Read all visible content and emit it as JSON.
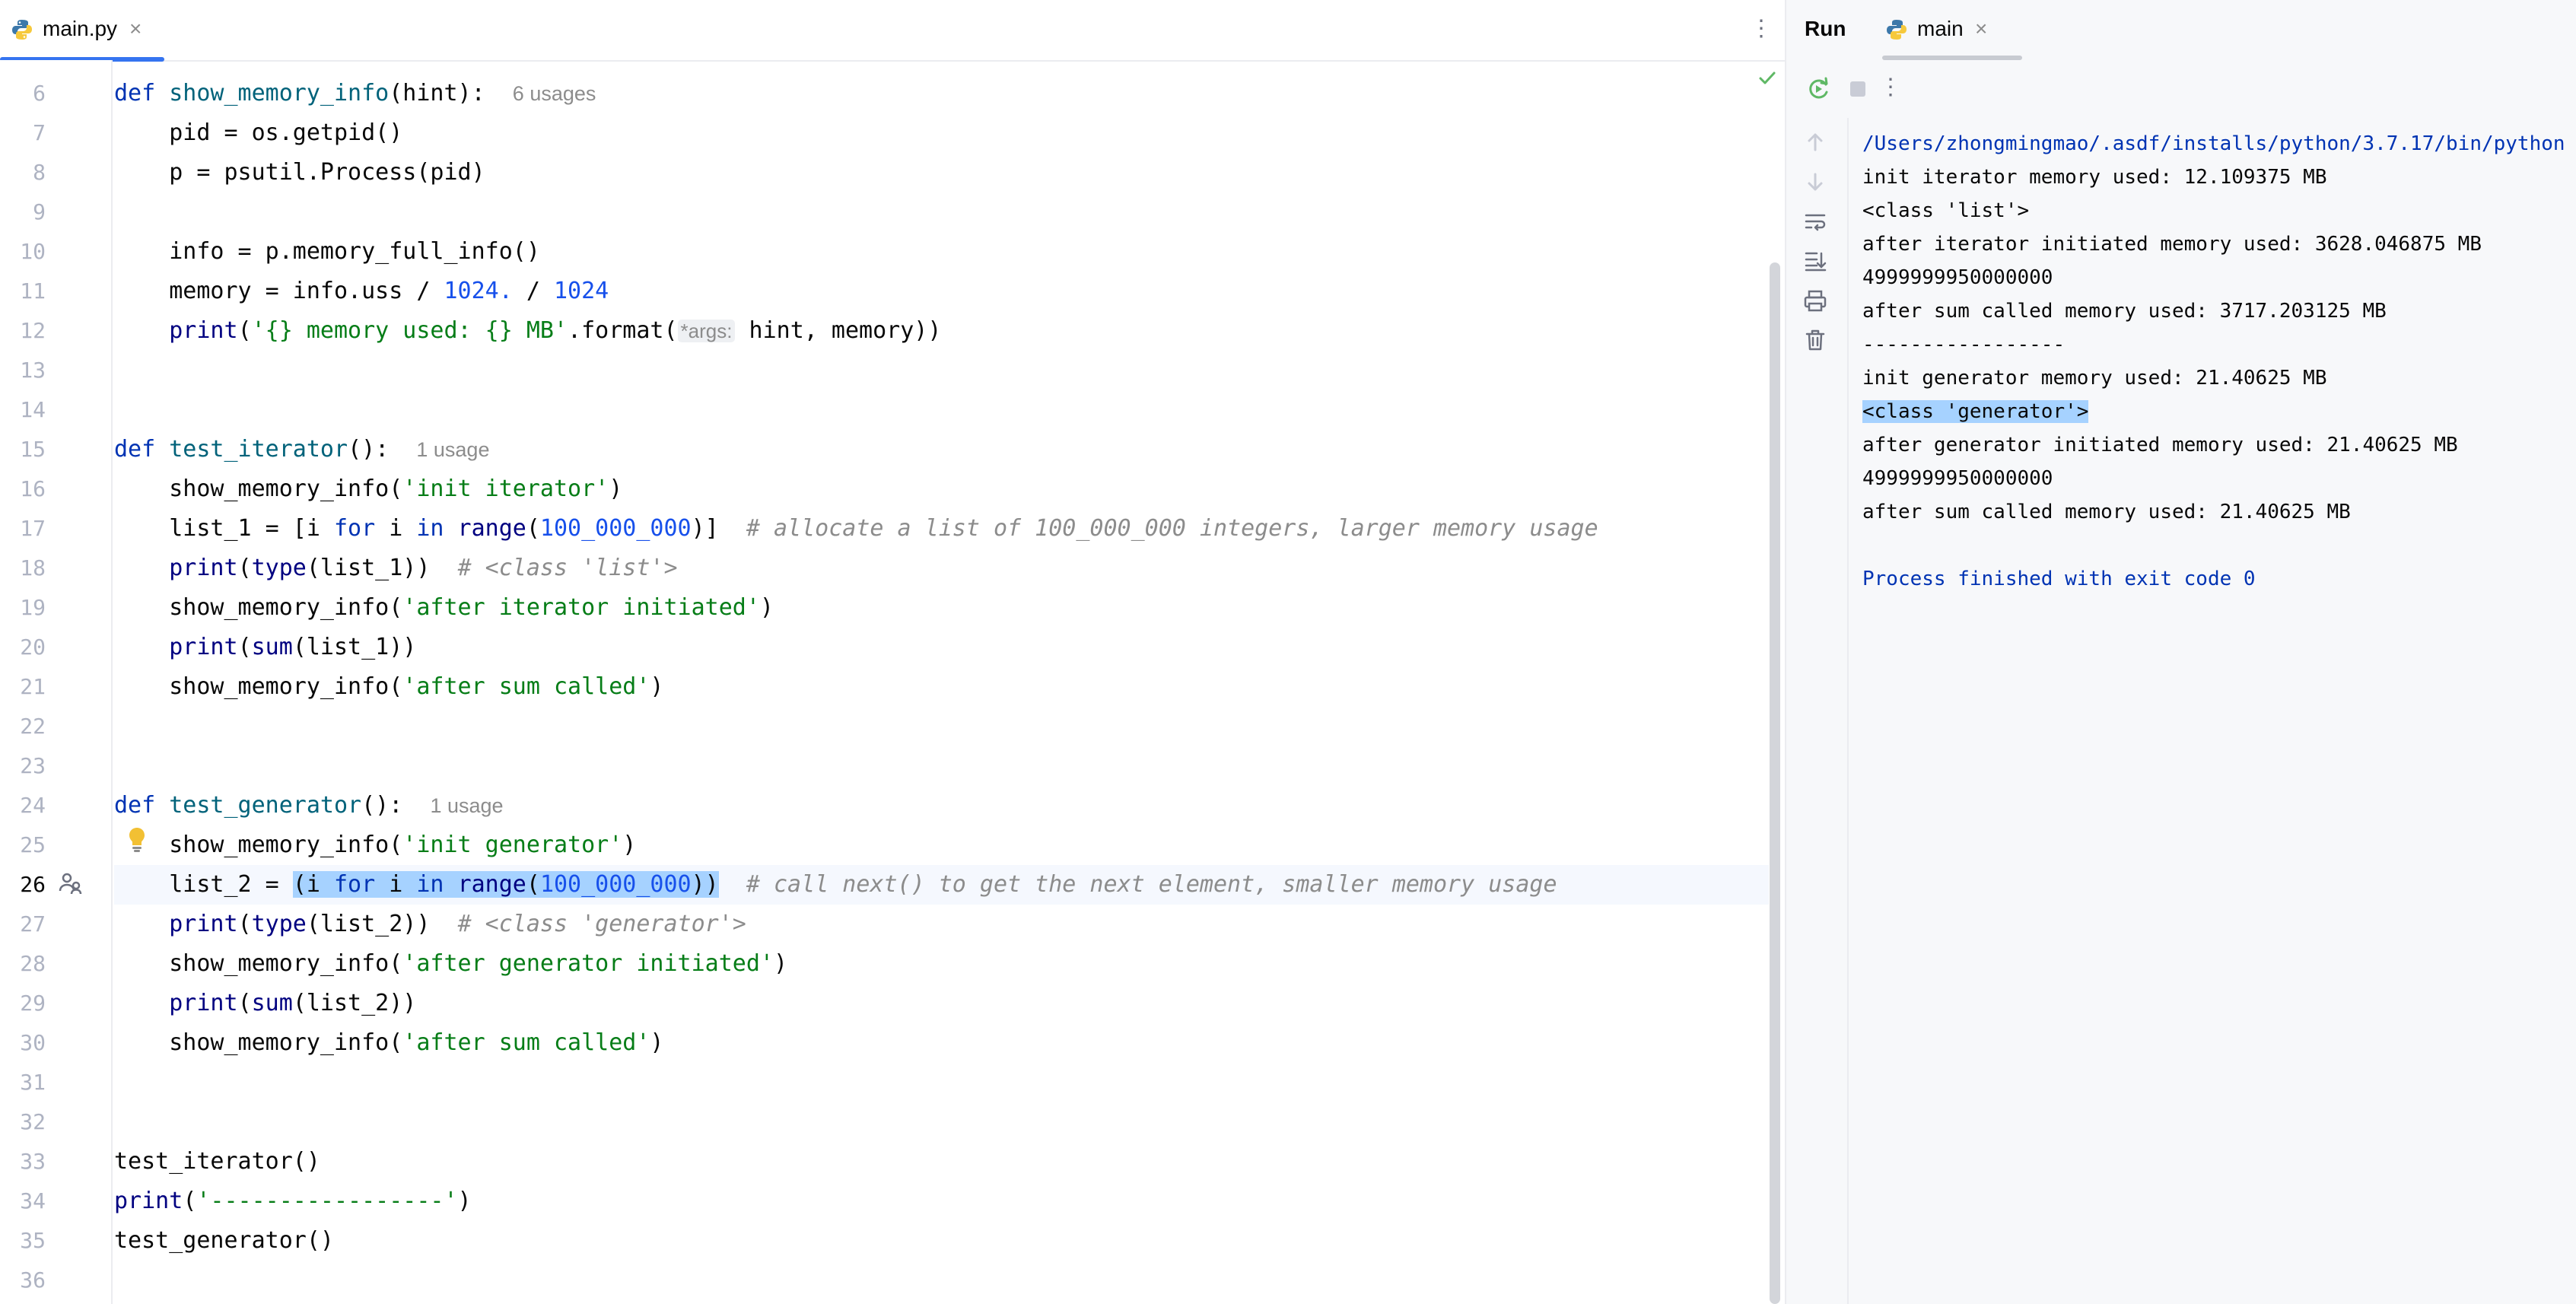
{
  "editor": {
    "tab": {
      "filename": "main.py",
      "close": "×"
    },
    "more_icon": "⋮",
    "lines": [
      {
        "n": "6",
        "tokens": [
          {
            "t": "def ",
            "c": "kw"
          },
          {
            "t": "show_memory_info",
            "c": "fn"
          },
          {
            "t": "(hint):  "
          },
          {
            "t": "6 usages",
            "c": "hint"
          }
        ]
      },
      {
        "n": "7",
        "tokens": [
          {
            "t": "    pid = os.getpid()"
          }
        ]
      },
      {
        "n": "8",
        "tokens": [
          {
            "t": "    p = psutil.Process(pid)"
          }
        ]
      },
      {
        "n": "9",
        "tokens": []
      },
      {
        "n": "10",
        "tokens": [
          {
            "t": "    info = p.memory_full_info()"
          }
        ]
      },
      {
        "n": "11",
        "tokens": [
          {
            "t": "    memory = info.uss / "
          },
          {
            "t": "1024.",
            "c": "num"
          },
          {
            "t": " / "
          },
          {
            "t": "1024",
            "c": "num"
          }
        ]
      },
      {
        "n": "12",
        "tokens": [
          {
            "t": "    "
          },
          {
            "t": "print",
            "c": "bi"
          },
          {
            "t": "("
          },
          {
            "t": "'{} memory used: {} MB'",
            "c": "str"
          },
          {
            "t": ".format("
          },
          {
            "t": "*args:",
            "c": "param"
          },
          {
            "t": " hint, memory))"
          }
        ]
      },
      {
        "n": "13",
        "tokens": []
      },
      {
        "n": "14",
        "tokens": []
      },
      {
        "n": "15",
        "tokens": [
          {
            "t": "def ",
            "c": "kw"
          },
          {
            "t": "test_iterator",
            "c": "fn"
          },
          {
            "t": "():  "
          },
          {
            "t": "1 usage",
            "c": "hint"
          }
        ]
      },
      {
        "n": "16",
        "tokens": [
          {
            "t": "    show_memory_info("
          },
          {
            "t": "'init iterator'",
            "c": "str"
          },
          {
            "t": ")"
          }
        ]
      },
      {
        "n": "17",
        "tokens": [
          {
            "t": "    list_1 = [i "
          },
          {
            "t": "for",
            "c": "kw"
          },
          {
            "t": " i "
          },
          {
            "t": "in",
            "c": "kw"
          },
          {
            "t": " "
          },
          {
            "t": "range",
            "c": "bi"
          },
          {
            "t": "("
          },
          {
            "t": "100_000_000",
            "c": "num"
          },
          {
            "t": ")]  "
          },
          {
            "t": "# allocate a list of 100_000_000 integers, larger memory usage",
            "c": "cm"
          }
        ]
      },
      {
        "n": "18",
        "tokens": [
          {
            "t": "    "
          },
          {
            "t": "print",
            "c": "bi"
          },
          {
            "t": "("
          },
          {
            "t": "type",
            "c": "bi"
          },
          {
            "t": "(list_1))  "
          },
          {
            "t": "# <class 'list'>",
            "c": "cm"
          }
        ]
      },
      {
        "n": "19",
        "tokens": [
          {
            "t": "    show_memory_info("
          },
          {
            "t": "'after iterator initiated'",
            "c": "str"
          },
          {
            "t": ")"
          }
        ]
      },
      {
        "n": "20",
        "tokens": [
          {
            "t": "    "
          },
          {
            "t": "print",
            "c": "bi"
          },
          {
            "t": "("
          },
          {
            "t": "sum",
            "c": "bi"
          },
          {
            "t": "(list_1))"
          }
        ]
      },
      {
        "n": "21",
        "tokens": [
          {
            "t": "    show_memory_info("
          },
          {
            "t": "'after sum called'",
            "c": "str"
          },
          {
            "t": ")"
          }
        ]
      },
      {
        "n": "22",
        "tokens": []
      },
      {
        "n": "23",
        "tokens": []
      },
      {
        "n": "24",
        "tokens": [
          {
            "t": "def ",
            "c": "kw"
          },
          {
            "t": "test_generator",
            "c": "fn"
          },
          {
            "t": "():  "
          },
          {
            "t": "1 usage",
            "c": "hint"
          }
        ]
      },
      {
        "n": "25",
        "tokens": [
          {
            "t": "    show_memory_info("
          },
          {
            "t": "'init generator'",
            "c": "str"
          },
          {
            "t": ")"
          }
        ]
      },
      {
        "n": "26",
        "current": true,
        "tokens": [
          {
            "t": "    list_2 = "
          },
          {
            "t": "(i ",
            "c": "sel"
          },
          {
            "t": "for",
            "c": "kw sel"
          },
          {
            "t": " i ",
            "c": "sel"
          },
          {
            "t": "in",
            "c": "kw sel"
          },
          {
            "t": " ",
            "c": "sel"
          },
          {
            "t": "range",
            "c": "bi sel"
          },
          {
            "t": "(",
            "c": "sel"
          },
          {
            "t": "100_000_000",
            "c": "num sel"
          },
          {
            "t": "))",
            "c": "sel"
          },
          {
            "t": "  "
          },
          {
            "t": "# call next() to get the next element, smaller memory usage",
            "c": "cm"
          }
        ]
      },
      {
        "n": "27",
        "tokens": [
          {
            "t": "    "
          },
          {
            "t": "print",
            "c": "bi"
          },
          {
            "t": "("
          },
          {
            "t": "type",
            "c": "bi"
          },
          {
            "t": "(list_2))  "
          },
          {
            "t": "# <class 'generator'>",
            "c": "cm"
          }
        ]
      },
      {
        "n": "28",
        "tokens": [
          {
            "t": "    show_memory_info("
          },
          {
            "t": "'after generator initiated'",
            "c": "str"
          },
          {
            "t": ")"
          }
        ]
      },
      {
        "n": "29",
        "tokens": [
          {
            "t": "    "
          },
          {
            "t": "print",
            "c": "bi"
          },
          {
            "t": "("
          },
          {
            "t": "sum",
            "c": "bi"
          },
          {
            "t": "(list_2))"
          }
        ]
      },
      {
        "n": "30",
        "tokens": [
          {
            "t": "    show_memory_info("
          },
          {
            "t": "'after sum called'",
            "c": "str"
          },
          {
            "t": ")"
          }
        ]
      },
      {
        "n": "31",
        "tokens": []
      },
      {
        "n": "32",
        "tokens": []
      },
      {
        "n": "33",
        "tokens": [
          {
            "t": "test_iterator()"
          }
        ]
      },
      {
        "n": "34",
        "tokens": [
          {
            "t": "print",
            "c": "bi"
          },
          {
            "t": "("
          },
          {
            "t": "'-----------------'",
            "c": "str"
          },
          {
            "t": ")"
          }
        ]
      },
      {
        "n": "35",
        "tokens": [
          {
            "t": "test_generator()"
          }
        ]
      },
      {
        "n": "36",
        "tokens": []
      }
    ]
  },
  "run_panel": {
    "title": "Run",
    "tab": {
      "label": "main",
      "close": "×"
    },
    "more_icon": "⋮",
    "output": [
      {
        "text": "/Users/zhongmingmao/.asdf/installs/python/3.7.17/bin/python",
        "kind": "path"
      },
      {
        "text": "init iterator memory used: 12.109375 MB"
      },
      {
        "text": "<class 'list'>"
      },
      {
        "text": "after iterator initiated memory used: 3628.046875 MB"
      },
      {
        "text": "4999999950000000"
      },
      {
        "text": "after sum called memory used: 3717.203125 MB"
      },
      {
        "text": "-----------------"
      },
      {
        "text": "init generator memory used: 21.40625 MB"
      },
      {
        "text": "<class 'generator'>",
        "kind": "highlight"
      },
      {
        "text": "after generator initiated memory used: 21.40625 MB"
      },
      {
        "text": "4999999950000000"
      },
      {
        "text": "after sum called memory used: 21.40625 MB"
      },
      {
        "text": ""
      },
      {
        "text": "Process finished with exit code 0",
        "kind": "exit"
      }
    ]
  },
  "colors": {
    "accent": "#3574f0",
    "keyword": "#0033b3",
    "string": "#067d17",
    "number": "#1750eb",
    "comment": "#8c8c8c",
    "selection": "#a6d2ff"
  }
}
